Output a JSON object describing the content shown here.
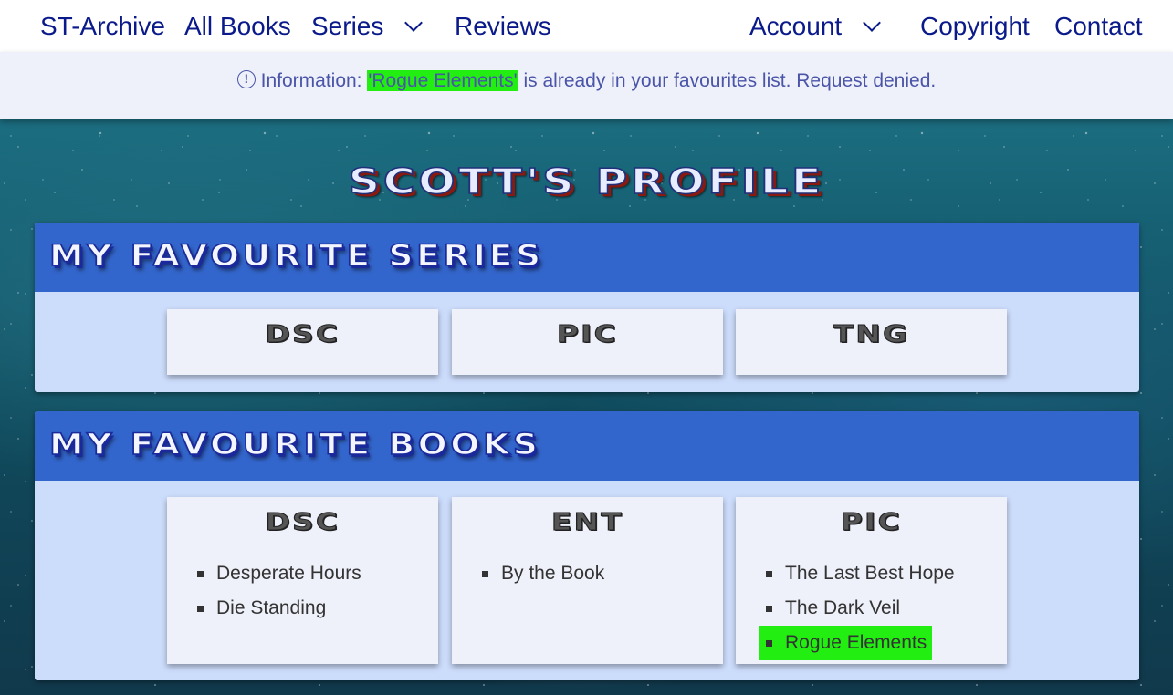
{
  "nav": {
    "brand": "ST-Archive",
    "all_books": "All Books",
    "series": "Series",
    "reviews": "Reviews",
    "account": "Account",
    "copyright": "Copyright",
    "contact": "Contact"
  },
  "alert": {
    "icon": "info-circle-icon",
    "prefix": "Information: ",
    "highlight": "'Rogue Elements'",
    "suffix": " is already in your favourites list. Request denied."
  },
  "page_title": "Scott's Profile",
  "series_panel": {
    "title": "My Favourite Series",
    "cards": [
      {
        "title": "DSC"
      },
      {
        "title": "PIC"
      },
      {
        "title": "TNG"
      }
    ]
  },
  "books_panel": {
    "title": "My Favourite Books",
    "cards": [
      {
        "title": "DSC",
        "books": [
          "Desperate Hours",
          "Die Standing"
        ]
      },
      {
        "title": "ENT",
        "books": [
          "By the Book"
        ]
      },
      {
        "title": "PIC",
        "books": [
          "The Last Best Hope",
          "The Dark Veil",
          "Rogue Elements"
        ]
      }
    ]
  },
  "colors": {
    "nav_text": "#0a1a8a",
    "alert_bg": "#eef0fa",
    "highlight": "#22ee11",
    "panel_head": "#3366cc",
    "panel_body": "#ccdcfb"
  }
}
